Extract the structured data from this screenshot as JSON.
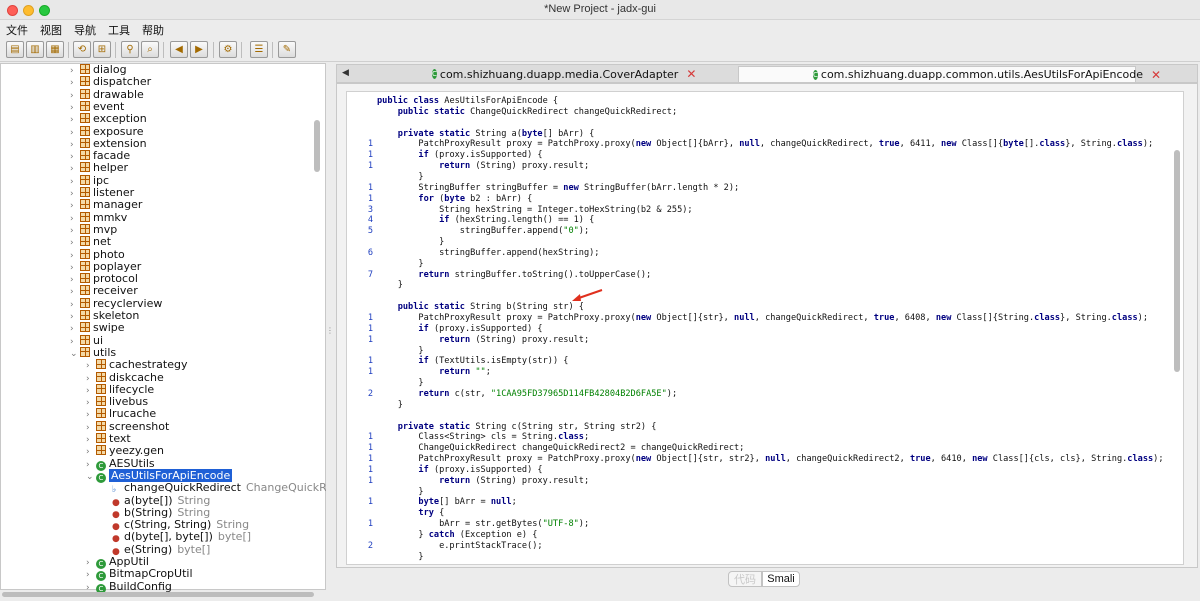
{
  "window": {
    "title": "*New Project - jadx-gui"
  },
  "menu": [
    "文件",
    "视图",
    "导航",
    "工具",
    "帮助"
  ],
  "toolbar": [
    "open-project-icon",
    "add-files-icon",
    "save-project-icon",
    "sync-icon",
    "flatten-icon",
    "search-icon",
    "find-class-icon",
    "back-icon",
    "forward-icon",
    "decompile-icon",
    "log-icon",
    "preferences-icon"
  ],
  "tree": [
    {
      "label": "dialog",
      "kind": "package",
      "level": 0,
      "arrow": "›"
    },
    {
      "label": "dispatcher",
      "kind": "package",
      "level": 0,
      "arrow": "›"
    },
    {
      "label": "drawable",
      "kind": "package",
      "level": 0,
      "arrow": "›"
    },
    {
      "label": "event",
      "kind": "package",
      "level": 0,
      "arrow": "›"
    },
    {
      "label": "exception",
      "kind": "package",
      "level": 0,
      "arrow": "›"
    },
    {
      "label": "exposure",
      "kind": "package",
      "level": 0,
      "arrow": "›"
    },
    {
      "label": "extension",
      "kind": "package",
      "level": 0,
      "arrow": "›"
    },
    {
      "label": "facade",
      "kind": "package",
      "level": 0,
      "arrow": "›"
    },
    {
      "label": "helper",
      "kind": "package",
      "level": 0,
      "arrow": "›"
    },
    {
      "label": "ipc",
      "kind": "package",
      "level": 0,
      "arrow": "›"
    },
    {
      "label": "listener",
      "kind": "package",
      "level": 0,
      "arrow": "›"
    },
    {
      "label": "manager",
      "kind": "package",
      "level": 0,
      "arrow": "›"
    },
    {
      "label": "mmkv",
      "kind": "package",
      "level": 0,
      "arrow": "›"
    },
    {
      "label": "mvp",
      "kind": "package",
      "level": 0,
      "arrow": "›"
    },
    {
      "label": "net",
      "kind": "package",
      "level": 0,
      "arrow": "›"
    },
    {
      "label": "photo",
      "kind": "package",
      "level": 0,
      "arrow": "›"
    },
    {
      "label": "poplayer",
      "kind": "package",
      "level": 0,
      "arrow": "›"
    },
    {
      "label": "protocol",
      "kind": "package",
      "level": 0,
      "arrow": "›"
    },
    {
      "label": "receiver",
      "kind": "package",
      "level": 0,
      "arrow": "›"
    },
    {
      "label": "recyclerview",
      "kind": "package",
      "level": 0,
      "arrow": "›"
    },
    {
      "label": "skeleton",
      "kind": "package",
      "level": 0,
      "arrow": "›"
    },
    {
      "label": "swipe",
      "kind": "package",
      "level": 0,
      "arrow": "›"
    },
    {
      "label": "ui",
      "kind": "package",
      "level": 0,
      "arrow": "›"
    },
    {
      "label": "utils",
      "kind": "package",
      "level": 0,
      "arrow": "⌄"
    },
    {
      "label": "cachestrategy",
      "kind": "package",
      "level": 1,
      "arrow": "›"
    },
    {
      "label": "diskcache",
      "kind": "package",
      "level": 1,
      "arrow": "›"
    },
    {
      "label": "lifecycle",
      "kind": "package",
      "level": 1,
      "arrow": "›"
    },
    {
      "label": "livebus",
      "kind": "package",
      "level": 1,
      "arrow": "›"
    },
    {
      "label": "lrucache",
      "kind": "package",
      "level": 1,
      "arrow": "›"
    },
    {
      "label": "screenshot",
      "kind": "package",
      "level": 1,
      "arrow": "›"
    },
    {
      "label": "text",
      "kind": "package",
      "level": 1,
      "arrow": "›"
    },
    {
      "label": "yeezy.gen",
      "kind": "package",
      "level": 1,
      "arrow": "›"
    },
    {
      "label": "AESUtils",
      "kind": "class",
      "level": 1,
      "arrow": "›"
    },
    {
      "label": "AesUtilsForApiEncode",
      "kind": "class",
      "level": 1,
      "arrow": "⌄",
      "selected": true
    },
    {
      "label": "changeQuickRedirect",
      "type": "ChangeQuickR",
      "kind": "field",
      "level": 2,
      "arrow": ""
    },
    {
      "label": "a(byte[])",
      "type": "String",
      "kind": "method",
      "level": 2,
      "arrow": ""
    },
    {
      "label": "b(String)",
      "type": "String",
      "kind": "method",
      "level": 2,
      "arrow": ""
    },
    {
      "label": "c(String, String)",
      "type": "String",
      "kind": "method",
      "level": 2,
      "arrow": ""
    },
    {
      "label": "d(byte[], byte[])",
      "type": "byte[]",
      "kind": "method",
      "level": 2,
      "arrow": ""
    },
    {
      "label": "e(String)",
      "type": "byte[]",
      "kind": "method",
      "level": 2,
      "arrow": ""
    },
    {
      "label": "AppUtil",
      "kind": "class",
      "level": 1,
      "arrow": "›"
    },
    {
      "label": "BitmapCropUtil",
      "kind": "class",
      "level": 1,
      "arrow": "›"
    },
    {
      "label": "BuildConfig",
      "kind": "class",
      "level": 1,
      "arrow": "›"
    }
  ],
  "tabs": [
    {
      "label": "com.shizhuang.duapp.media.CoverAdapter",
      "active": false
    },
    {
      "label": "com.shizhuang.duapp.common.utils.AesUtilsForApiEncode",
      "active": true
    }
  ],
  "code": [
    {
      "ln": "",
      "text": "public class AesUtilsForApiEncode {"
    },
    {
      "ln": "",
      "text": "    public static ChangeQuickRedirect changeQuickRedirect;"
    },
    {
      "ln": "",
      "text": ""
    },
    {
      "ln": "",
      "text": "    private static String a(byte[] bArr) {"
    },
    {
      "ln": "1",
      "text": "        PatchProxyResult proxy = PatchProxy.proxy(new Object[]{bArr}, null, changeQuickRedirect, true, 6411, new Class[]{byte[].class}, String.class);"
    },
    {
      "ln": "1",
      "text": "        if (proxy.isSupported) {"
    },
    {
      "ln": "1",
      "text": "            return (String) proxy.result;"
    },
    {
      "ln": "",
      "text": "        }"
    },
    {
      "ln": "1",
      "text": "        StringBuffer stringBuffer = new StringBuffer(bArr.length * 2);"
    },
    {
      "ln": "1",
      "text": "        for (byte b2 : bArr) {"
    },
    {
      "ln": "3",
      "text": "            String hexString = Integer.toHexString(b2 & 255);"
    },
    {
      "ln": "4",
      "text": "            if (hexString.length() == 1) {"
    },
    {
      "ln": "5",
      "text": "                stringBuffer.append(\"0\");"
    },
    {
      "ln": "",
      "text": "            }"
    },
    {
      "ln": "6",
      "text": "            stringBuffer.append(hexString);"
    },
    {
      "ln": "",
      "text": "        }"
    },
    {
      "ln": "7",
      "text": "        return stringBuffer.toString().toUpperCase();"
    },
    {
      "ln": "",
      "text": "    }"
    },
    {
      "ln": "",
      "text": ""
    },
    {
      "ln": "",
      "text": "    public static String b(String str) {"
    },
    {
      "ln": "1",
      "text": "        PatchProxyResult proxy = PatchProxy.proxy(new Object[]{str}, null, changeQuickRedirect, true, 6408, new Class[]{String.class}, String.class);"
    },
    {
      "ln": "1",
      "text": "        if (proxy.isSupported) {"
    },
    {
      "ln": "1",
      "text": "            return (String) proxy.result;"
    },
    {
      "ln": "",
      "text": "        }"
    },
    {
      "ln": "1",
      "text": "        if (TextUtils.isEmpty(str)) {"
    },
    {
      "ln": "1",
      "text": "            return \"\";"
    },
    {
      "ln": "",
      "text": "        }"
    },
    {
      "ln": "2",
      "text": "        return c(str, \"1CAA95FD37965D114FB42804B2D6FA5E\");"
    },
    {
      "ln": "",
      "text": "    }"
    },
    {
      "ln": "",
      "text": ""
    },
    {
      "ln": "",
      "text": "    private static String c(String str, String str2) {"
    },
    {
      "ln": "1",
      "text": "        Class<String> cls = String.class;"
    },
    {
      "ln": "1",
      "text": "        ChangeQuickRedirect changeQuickRedirect2 = changeQuickRedirect;"
    },
    {
      "ln": "1",
      "text": "        PatchProxyResult proxy = PatchProxy.proxy(new Object[]{str, str2}, null, changeQuickRedirect2, true, 6410, new Class[]{cls, cls}, String.class);"
    },
    {
      "ln": "1",
      "text": "        if (proxy.isSupported) {"
    },
    {
      "ln": "1",
      "text": "            return (String) proxy.result;"
    },
    {
      "ln": "",
      "text": "        }"
    },
    {
      "ln": "1",
      "text": "        byte[] bArr = null;"
    },
    {
      "ln": "",
      "text": "        try {"
    },
    {
      "ln": "1",
      "text": "            bArr = str.getBytes(\"UTF-8\");"
    },
    {
      "ln": "",
      "text": "        } catch (Exception e) {"
    },
    {
      "ln": "2",
      "text": "            e.printStackTrace();"
    },
    {
      "ln": "",
      "text": "        }"
    }
  ],
  "bottom_tabs": {
    "code": "代码",
    "smali": "Smali"
  },
  "colors": {
    "selection": "#1f60d6",
    "keyword": "#000080",
    "string": "#008000",
    "line_number": "#1f3fbf",
    "annotation_arrow": "#e0301e"
  }
}
